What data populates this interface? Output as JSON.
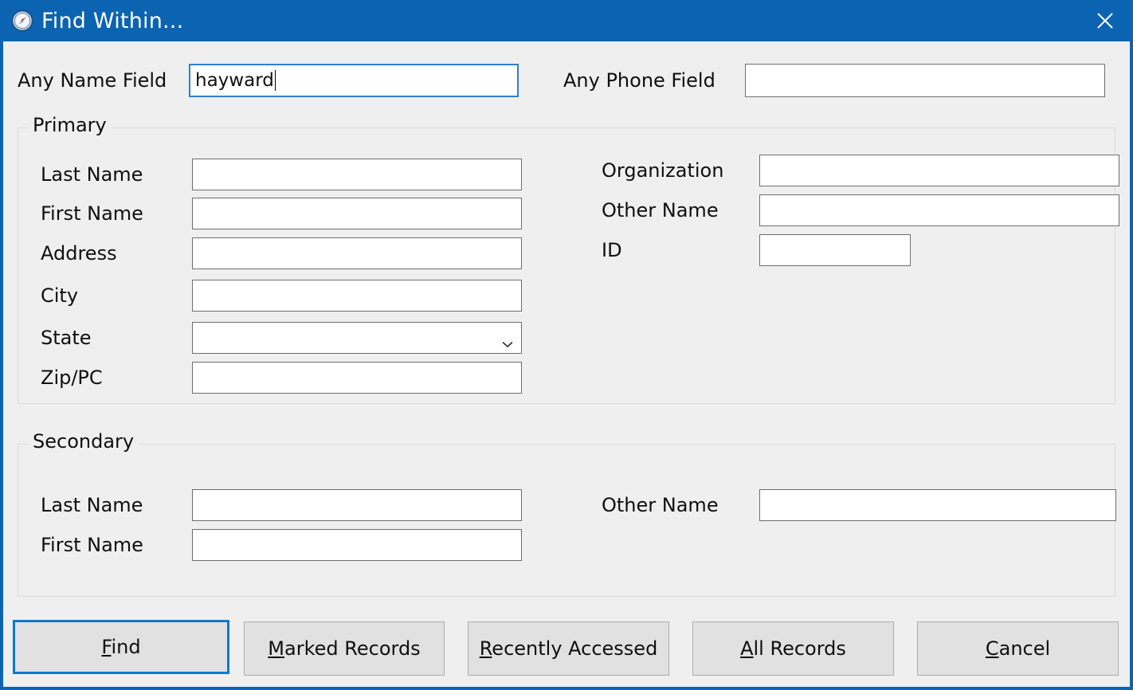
{
  "window": {
    "title": "Find Within...",
    "icon": "compass-icon",
    "close_icon": "close-icon",
    "titlebar_color": "#0b64b2",
    "client_color": "#efefef",
    "accent_color": "#0b7ad1"
  },
  "top_fields": [
    {
      "label": "Any Name Field",
      "value": "hayward",
      "placeholder": "",
      "focused": true
    },
    {
      "label": "Any Phone Field",
      "value": "",
      "placeholder": "",
      "focused": false
    }
  ],
  "primary": {
    "title": "Primary",
    "left_fields": [
      {
        "label": "Last Name",
        "value": "",
        "placeholder": "",
        "type": "text"
      },
      {
        "label": "First Name",
        "value": "",
        "placeholder": "",
        "type": "text"
      },
      {
        "label": "Address",
        "value": "",
        "placeholder": "",
        "type": "text"
      },
      {
        "label": "City",
        "value": "",
        "placeholder": "",
        "type": "text"
      },
      {
        "label": "State",
        "value": "",
        "placeholder": "",
        "type": "combo"
      },
      {
        "label": "Zip/PC",
        "value": "",
        "placeholder": "",
        "type": "text"
      }
    ],
    "right_fields": [
      {
        "label": "Organization",
        "value": "",
        "placeholder": "",
        "type": "text"
      },
      {
        "label": "Other Name",
        "value": "",
        "placeholder": "",
        "type": "text"
      },
      {
        "label": "ID",
        "value": "",
        "placeholder": "",
        "type": "text"
      }
    ]
  },
  "secondary": {
    "title": "Secondary",
    "left_fields": [
      {
        "label": "Last Name",
        "value": "",
        "placeholder": "",
        "type": "text"
      },
      {
        "label": "First Name",
        "value": "",
        "placeholder": "",
        "type": "text"
      }
    ],
    "right_fields": [
      {
        "label": "Other Name",
        "value": "",
        "placeholder": "",
        "type": "text"
      }
    ]
  },
  "buttons": [
    {
      "name": "find",
      "accel": "F",
      "rest": "ind",
      "default": true
    },
    {
      "name": "marked-records",
      "accel": "M",
      "rest": "arked Records",
      "default": false
    },
    {
      "name": "recently-accessed",
      "accel": "R",
      "rest": "ecently Accessed",
      "default": false
    },
    {
      "name": "all-records",
      "accel": "A",
      "rest": "ll Records",
      "default": false
    },
    {
      "name": "cancel",
      "accel": "C",
      "rest": "ancel",
      "default": false
    }
  ]
}
